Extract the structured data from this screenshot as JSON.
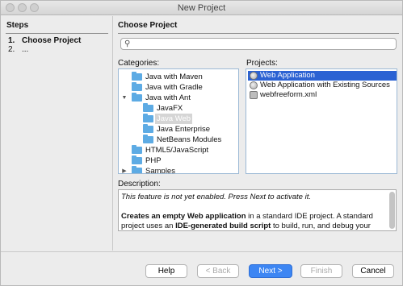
{
  "window": {
    "title": "New Project"
  },
  "steps": {
    "heading": "Steps",
    "items": [
      {
        "num": "1.",
        "label": "Choose Project"
      },
      {
        "num": "2.",
        "label": "..."
      }
    ]
  },
  "main": {
    "heading": "Choose Project",
    "search": {
      "value": "",
      "placeholder": ""
    },
    "categories_label": "Categories:",
    "projects_label": "Projects:",
    "categories": [
      {
        "label": "Java with Maven",
        "expander": "",
        "selected": false
      },
      {
        "label": "Java with Gradle",
        "expander": "",
        "selected": false
      },
      {
        "label": "Java with Ant",
        "expander": "▼",
        "selected": false
      },
      {
        "label": "JavaFX",
        "expander": "",
        "selected": false
      },
      {
        "label": "Java Web",
        "expander": "",
        "selected": true
      },
      {
        "label": "Java Enterprise",
        "expander": "",
        "selected": false
      },
      {
        "label": "NetBeans Modules",
        "expander": "",
        "selected": false
      },
      {
        "label": "HTML5/JavaScript",
        "expander": "",
        "selected": false
      },
      {
        "label": "PHP",
        "expander": "",
        "selected": false
      },
      {
        "label": "Samples",
        "expander": "▶",
        "selected": false
      }
    ],
    "projects": [
      {
        "label": "Web Application",
        "icon": "globe-icon",
        "selected": true
      },
      {
        "label": "Web Application with Existing Sources",
        "icon": "globe-icon",
        "selected": false
      },
      {
        "label": "webfreeform.xml",
        "icon": "gear-icon",
        "selected": false
      }
    ],
    "description_label": "Description:",
    "description": {
      "line1": "This feature is not yet enabled. Press Next to activate it.",
      "p2_a": "Creates an empty Web application",
      "p2_b": " in a standard IDE project. A standard project uses an ",
      "p2_c": "IDE-generated build script",
      "p2_d": " to build, run, and debug your"
    }
  },
  "buttons": {
    "help": "Help",
    "back": "< Back",
    "next": "Next >",
    "finish": "Finish",
    "cancel": "Cancel"
  },
  "colors": {
    "accent": "#3d86f3",
    "selection": "#2b62d3",
    "folder": "#5dabe4"
  }
}
